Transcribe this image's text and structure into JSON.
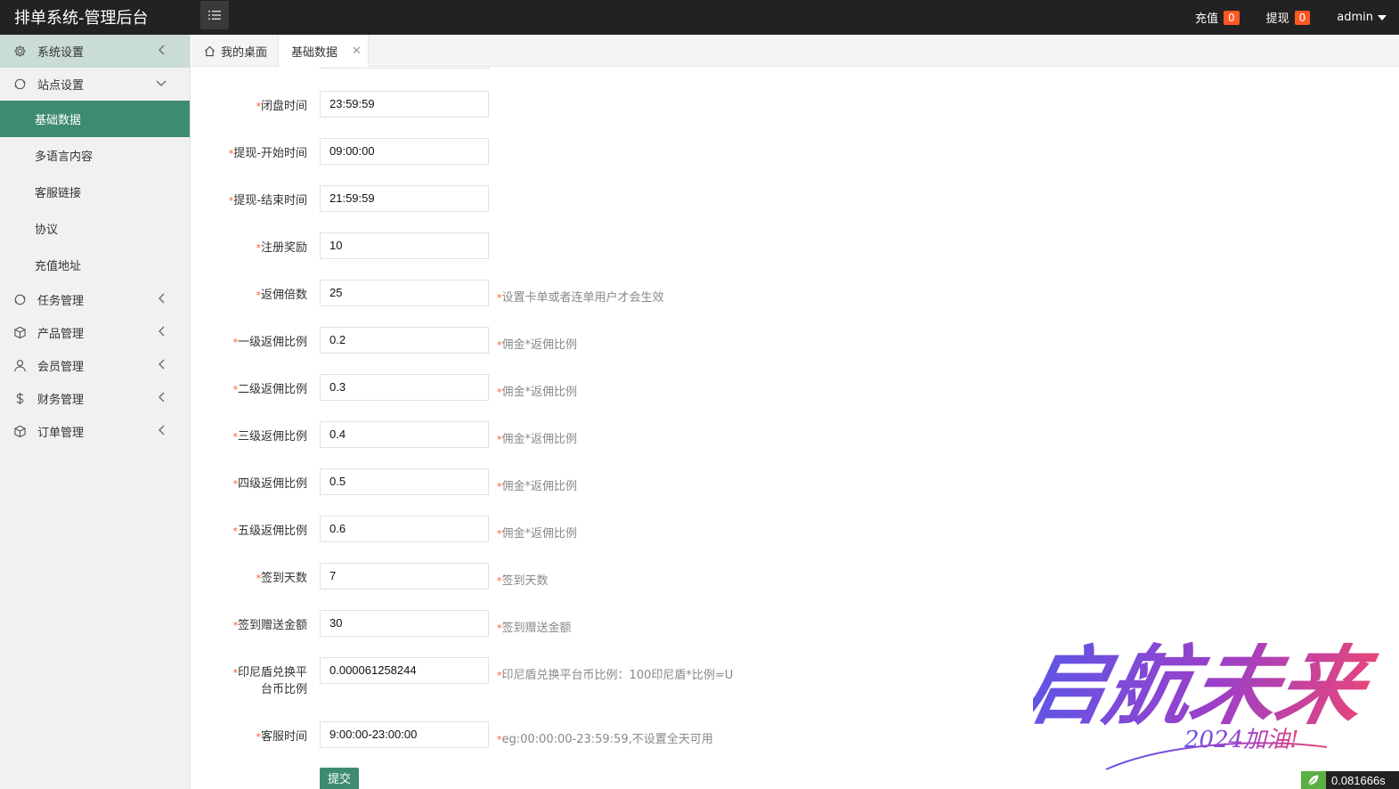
{
  "app": {
    "title": "排单系统-管理后台"
  },
  "header": {
    "recharge_label": "充值",
    "recharge_count": "0",
    "withdraw_label": "提现",
    "withdraw_count": "0",
    "user": "admin"
  },
  "sidebar": {
    "items": [
      {
        "label": "系统设置",
        "icon": "gear-icon"
      },
      {
        "label": "站点设置",
        "icon": "refresh-icon"
      },
      {
        "label": "任务管理",
        "icon": "refresh-icon"
      },
      {
        "label": "产品管理",
        "icon": "box-icon"
      },
      {
        "label": "会员管理",
        "icon": "user-icon"
      },
      {
        "label": "财务管理",
        "icon": "dollar-icon"
      },
      {
        "label": "订单管理",
        "icon": "box-icon"
      }
    ],
    "sub_items": [
      "基础数据",
      "多语言内容",
      "客服链接",
      "协议",
      "充值地址"
    ]
  },
  "tabs": [
    {
      "label": "我的桌面"
    },
    {
      "label": "基础数据"
    }
  ],
  "form": {
    "fields": [
      {
        "label": "闭盘时间",
        "value": "23:59:59",
        "hint": ""
      },
      {
        "label": "提现-开始时间",
        "value": "09:00:00",
        "hint": ""
      },
      {
        "label": "提现-结束时间",
        "value": "21:59:59",
        "hint": ""
      },
      {
        "label": "注册奖励",
        "value": "10",
        "hint": ""
      },
      {
        "label": "返佣倍数",
        "value": "25",
        "hint": "设置卡单或者连单用户才会生效"
      },
      {
        "label": "一级返佣比例",
        "value": "0.2",
        "hint": "佣金*返佣比例"
      },
      {
        "label": "二级返佣比例",
        "value": "0.3",
        "hint": "佣金*返佣比例"
      },
      {
        "label": "三级返佣比例",
        "value": "0.4",
        "hint": "佣金*返佣比例"
      },
      {
        "label": "四级返佣比例",
        "value": "0.5",
        "hint": "佣金*返佣比例"
      },
      {
        "label": "五级返佣比例",
        "value": "0.6",
        "hint": "佣金*返佣比例"
      },
      {
        "label": "签到天数",
        "value": "7",
        "hint": "签到天数"
      },
      {
        "label": "签到赠送金额",
        "value": "30",
        "hint": "签到赠送金额"
      },
      {
        "label": "印尼盾兑换平台币比例",
        "value": "0.000061258244",
        "hint": "印尼盾兑换平台币比例：100印尼盾*比例=U"
      },
      {
        "label": "客服时间",
        "value": "9:00:00-23:00:00",
        "hint": "eg:00:00:00-23:59:59,不设置全天可用"
      }
    ],
    "submit_label": "提交"
  },
  "watermark": {
    "text": "启航未来",
    "subtext": "2024加油!"
  },
  "timer": {
    "value": "0.081666s"
  },
  "colors": {
    "topbar": "#222222",
    "accent": "#3d8b73",
    "badge": "#ff5722",
    "sidebar_bg": "#f1f1f1"
  }
}
